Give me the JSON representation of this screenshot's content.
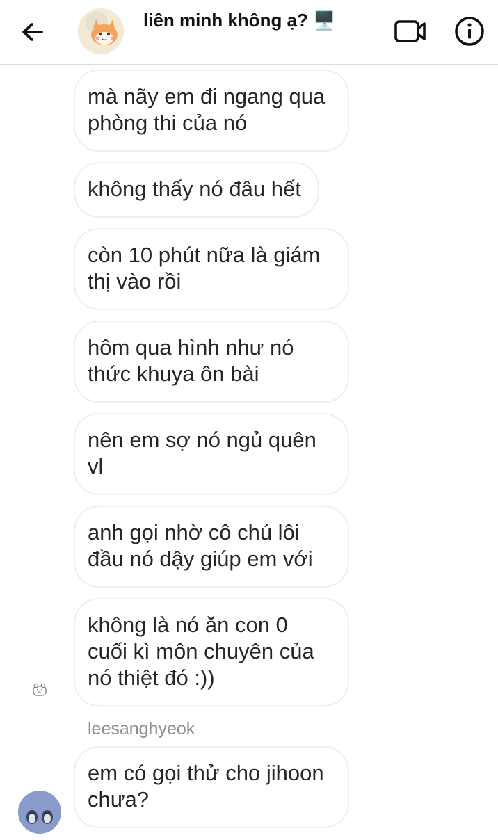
{
  "header": {
    "title": "liên minh không ạ? 🖥️",
    "back_icon": "arrow-left-icon",
    "video_icon": "video-call-icon",
    "info_icon": "info-icon"
  },
  "messages": [
    {
      "text_lines": [
        "mà nãy em đi ngang qua",
        "phòng thi của nó"
      ]
    },
    {
      "text_lines": [
        "không thấy nó đâu hết"
      ]
    },
    {
      "text_lines": [
        "còn 10 phút nữa là giám",
        "thị vào rồi"
      ]
    },
    {
      "text_lines": [
        "hôm qua hình như nó",
        "thức khuya ôn bài"
      ]
    },
    {
      "text_lines": [
        "nên em sợ nó ngủ quên",
        "vl"
      ]
    },
    {
      "text_lines": [
        "anh gọi nhờ cô chú lôi",
        "đầu nó dậy giúp em với"
      ]
    },
    {
      "text_lines": [
        "không là nó ăn con 0",
        "cuối kì môn chuyên của",
        "nó thiệt đó :))"
      ]
    }
  ],
  "reply": {
    "sender": "leesanghyeok",
    "text_lines": [
      "em có gọi thử cho jihoon",
      "chưa?"
    ]
  },
  "colors": {
    "bubble_border": "#efefef",
    "text": "#262626",
    "muted": "#8e8e8e"
  }
}
